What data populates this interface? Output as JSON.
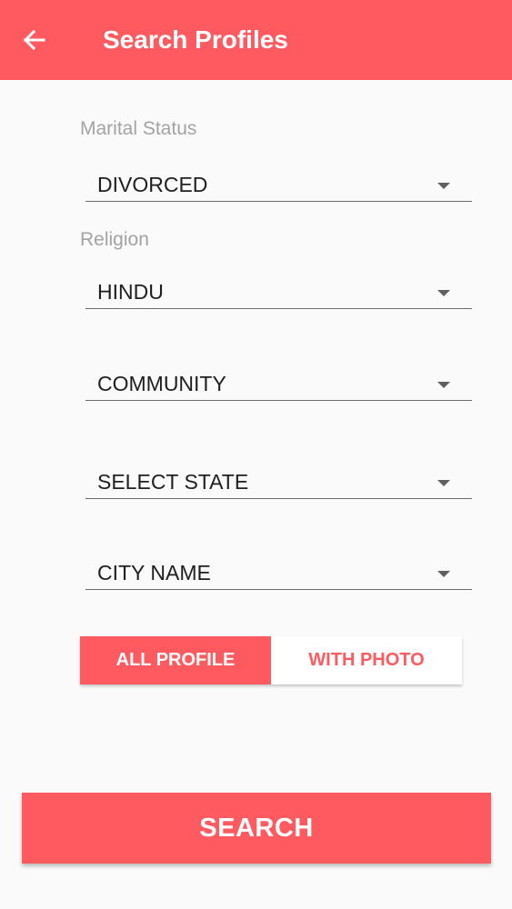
{
  "app_bar": {
    "title": "Search Profiles",
    "back_icon": "arrow-left-icon",
    "background": "#ff5a5f"
  },
  "form": {
    "marital_status": {
      "label": "Marital Status",
      "value": "DIVORCED"
    },
    "religion": {
      "label": "Religion",
      "value": "HINDU"
    },
    "community": {
      "value": "COMMUNITY"
    },
    "state": {
      "value": "SELECT STATE"
    },
    "city": {
      "value": "CITY NAME"
    },
    "dropdown_icon": "caret-down-icon"
  },
  "profile_filter": {
    "options": [
      "ALL PROFILE",
      "WITH PHOTO"
    ],
    "selected": "ALL PROFILE"
  },
  "search_button": {
    "label": "SEARCH"
  },
  "colors": {
    "accent": "#ff5a5f",
    "label": "#a3a3a3",
    "text": "#1f1f1f"
  }
}
